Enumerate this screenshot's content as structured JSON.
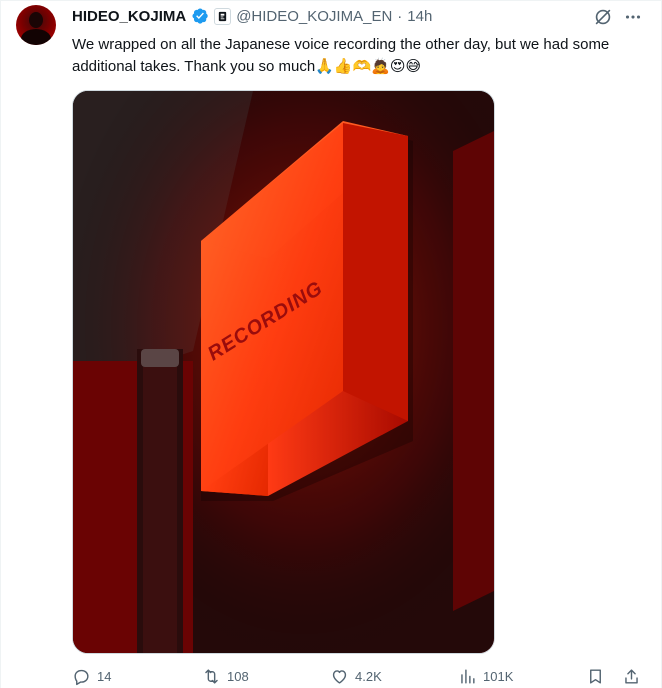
{
  "tweet": {
    "display_name": "HIDEO_KOJIMA",
    "handle": "@HIDEO_KOJIMA_EN",
    "separator": "·",
    "time": "14h",
    "text": "We wrapped on all the Japanese voice recording the other day, but we had some additional takes. Thank you so much🙏👍🫶🙇😍😅",
    "image_sign_text": "RECORDING"
  },
  "actions": {
    "replies": "14",
    "reposts": "108",
    "likes": "4.2K",
    "views": "101K"
  },
  "icons": {
    "verified": "verified-badge-icon",
    "affiliate": "affiliate-badge-icon",
    "grok": "grok-icon",
    "more": "more-icon",
    "reply": "reply-icon",
    "repost": "repost-icon",
    "like": "heart-icon",
    "views": "views-icon",
    "bookmark": "bookmark-icon",
    "share": "share-icon"
  },
  "colors": {
    "verified_blue": "#1d9bf0",
    "text_primary": "#0f1419",
    "text_secondary": "#536471",
    "sign_glow": "#ff3b10"
  }
}
